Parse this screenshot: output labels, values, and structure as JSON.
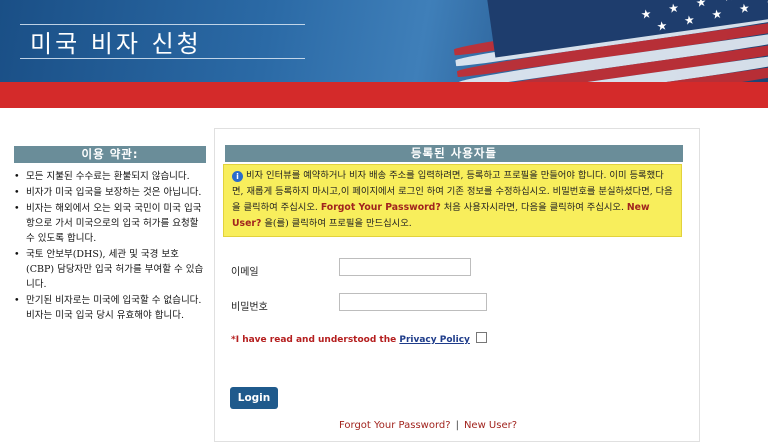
{
  "header": {
    "title": "미국 비자 신청"
  },
  "terms": {
    "heading": "이용 약관:",
    "items": [
      "모든 지불된 수수료는 환불되지 않습니다.",
      "비자가 미국 입국을 보장하는 것은 아닙니다.",
      "비자는 해외에서 오는 외국 국민이 미국 입국 항으로 가서 미국으로의 입국 허가를 요청할 수 있도록 합니다.",
      "국토 안보부(DHS), 세관 및 국경 보호(CBP) 담당자만 입국 허가를 부여할 수 있습니다.",
      "만기된 비자로는 미국에 입국할 수 없습니다. 비자는 미국 입국 당시 유효해야 합니다."
    ]
  },
  "registered": {
    "heading": "등록된 사용자들",
    "notice_part1": "비자 인터뷰를 예약하거나 비자 배송 주소를 입력하려면, 등록하고 프로필을 만들어야 합니다. 이미 등록했다면, 재롭게 등록하지 마시고,이 페이지에서 로그인 하여 기존 정보를 수정하십시오. 비밀번호를 분실하셨다면, 다음을 클릭하여 주십시오.",
    "notice_link1": "Forgot Your Password?",
    "notice_part2": "처음 사용자시라면, 다음을 클릭하여 주십시오.",
    "notice_link2": "New User?",
    "notice_part3": "을(를) 클릭하여 프로필을 만드십시오."
  },
  "form": {
    "email_label": "이메일",
    "email_value": "",
    "password_label": "비밀번호",
    "password_value": "",
    "privacy_prefix": "*I have read and understood the",
    "privacy_link": "Privacy Policy",
    "privacy_checked": false,
    "login_label": "Login"
  },
  "links": {
    "forgot": "Forgot Your Password?",
    "separator": "|",
    "new_user": "New User?"
  },
  "colors": {
    "red_bar": "#d42a2a",
    "section_header": "#6a8d99",
    "notice_bg": "#f8ee5c",
    "link_red": "#a1241e",
    "button": "#1f5a8c"
  }
}
